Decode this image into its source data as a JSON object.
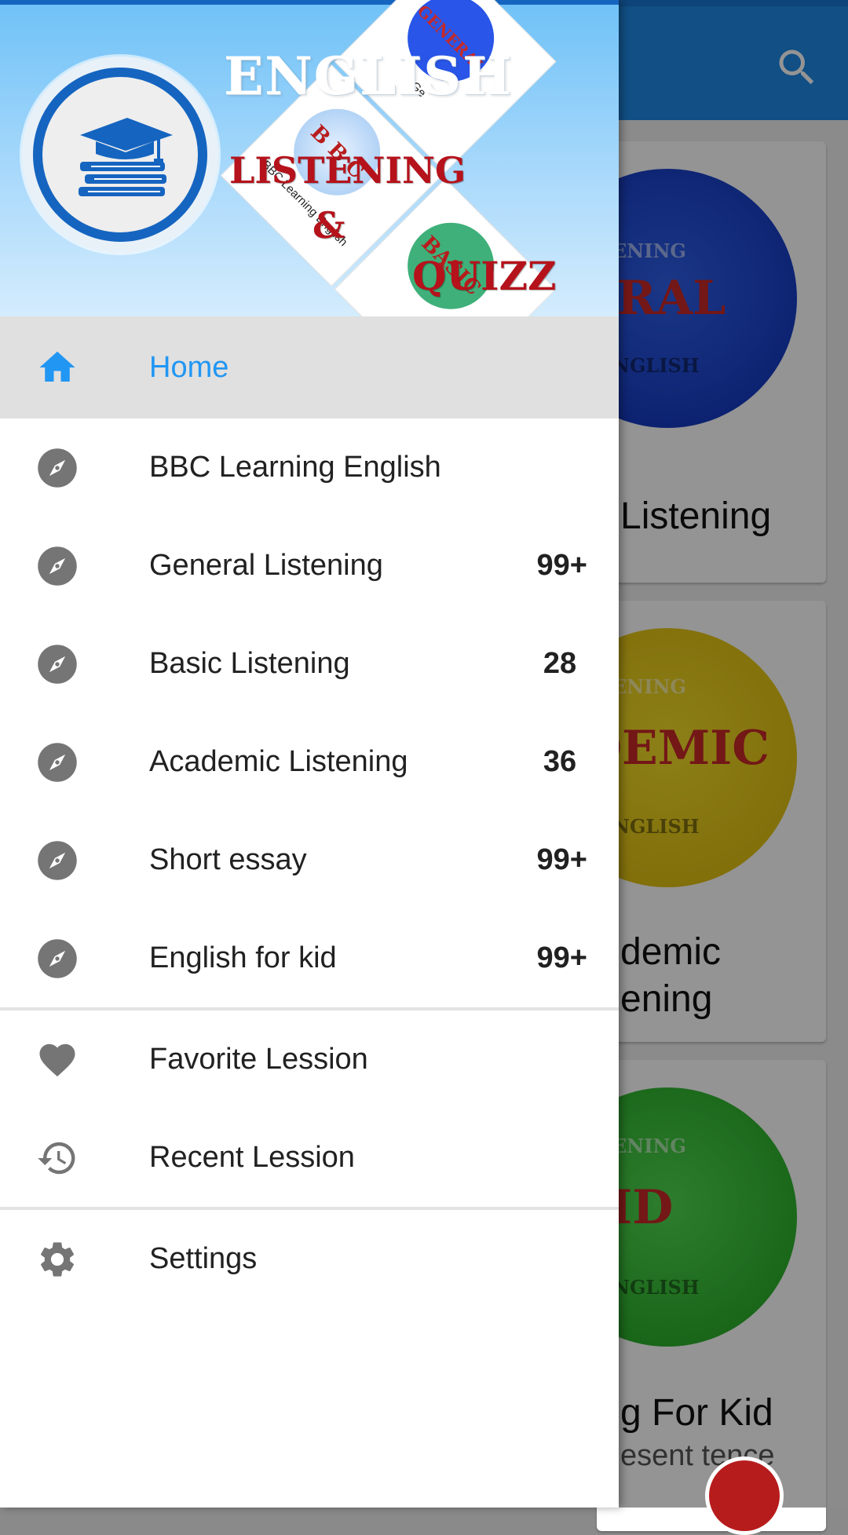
{
  "colors": {
    "accent": "#2196f3",
    "toolbar": "#1e88e5",
    "header_red": "#b5121b",
    "icon_gray": "#757575"
  },
  "background": {
    "search_icon": "search-icon",
    "cards": [
      {
        "circle_tag": "ENING",
        "circle_big": "ERAL",
        "circle_sub": "NGLISH",
        "title_lines": [
          "Listening"
        ],
        "subtitle": ""
      },
      {
        "circle_tag": "ENING",
        "circle_big": "DEMIC",
        "circle_sub": "NGLISH",
        "title_lines": [
          "demic",
          "ening"
        ],
        "subtitle": ""
      },
      {
        "circle_tag": "ENING",
        "circle_big": "KID",
        "circle_sub": "NGLISH",
        "title_lines": [
          "g For Kid"
        ],
        "subtitle": "esent tence"
      }
    ]
  },
  "drawer": {
    "header": {
      "title_english": "ENGLISH",
      "title_listening": "LISTENING",
      "title_amp": "&",
      "title_quizz": "QUIZZ",
      "logo_icon": "graduation-cap-books-icon",
      "thumbnails": [
        {
          "ball_text": "GENERAL",
          "caption": "Ge"
        },
        {
          "ball_text": "B B C",
          "caption": "BBC Learning English"
        },
        {
          "ball_text": "BASIC",
          "caption": ""
        }
      ]
    },
    "menu": [
      {
        "icon": "home-icon",
        "label": "Home",
        "count": "",
        "active": true
      },
      {
        "icon": "compass-icon",
        "label": "BBC Learning English",
        "count": ""
      },
      {
        "icon": "compass-icon",
        "label": "General Listening",
        "count": "99+"
      },
      {
        "icon": "compass-icon",
        "label": "Basic Listening",
        "count": "28"
      },
      {
        "icon": "compass-icon",
        "label": "Academic Listening",
        "count": "36"
      },
      {
        "icon": "compass-icon",
        "label": "Short essay",
        "count": "99+"
      },
      {
        "icon": "compass-icon",
        "label": "English for kid",
        "count": "99+"
      },
      {
        "icon": "heart-icon",
        "label": "Favorite Lession",
        "count": ""
      },
      {
        "icon": "history-icon",
        "label": "Recent Lession",
        "count": ""
      },
      {
        "icon": "gear-icon",
        "label": "Settings",
        "count": ""
      }
    ]
  }
}
